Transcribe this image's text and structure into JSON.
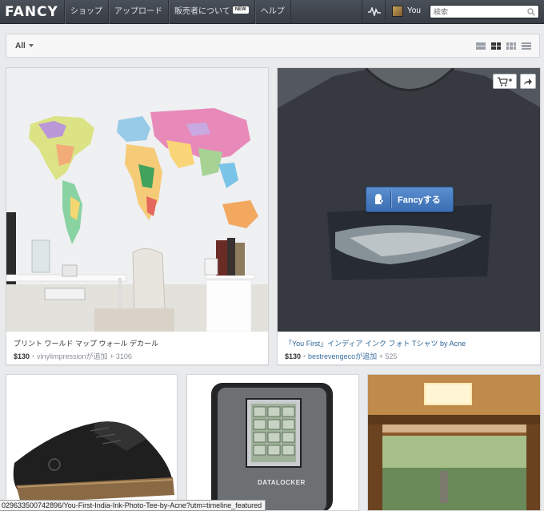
{
  "header": {
    "logo": "FANCY",
    "nav": [
      {
        "label": "ショップ"
      },
      {
        "label": "アップロード"
      },
      {
        "label": "販売者について",
        "badge": "NEW"
      },
      {
        "label": "ヘルプ"
      }
    ],
    "user_label": "You",
    "search_placeholder": "検索",
    "icons": [
      "activity-icon",
      "avatar",
      "search-icon"
    ]
  },
  "filter": {
    "selected": "All",
    "view_modes": [
      "list",
      "grid",
      "compact-grid",
      "lines"
    ],
    "active_view": "grid"
  },
  "cards": [
    {
      "title": "プリント ワールド マップ ウォール デカール",
      "price": "$130",
      "sep": "・",
      "user": "vinylimpressionが追加",
      "count": "+ 3106"
    },
    {
      "title": "「You First」インディア インク フォト Tシャツ by Acne",
      "price": "$130",
      "sep": "・",
      "user": "bestrevengecoが追加",
      "count": "+ 525",
      "fancy_button": "Fancyする"
    },
    {
      "title": "",
      "device_label": "DATALOCKER"
    },
    {
      "title": ""
    },
    {
      "title": ""
    }
  ],
  "status_url": "029633500742896/You-First-India-Ink-Photo-Tee-by-Acne?utm=timeline_featured",
  "colors": {
    "topbar": "#3f444b",
    "accent_blue": "#3b6db2",
    "link_blue": "#2a6496"
  }
}
